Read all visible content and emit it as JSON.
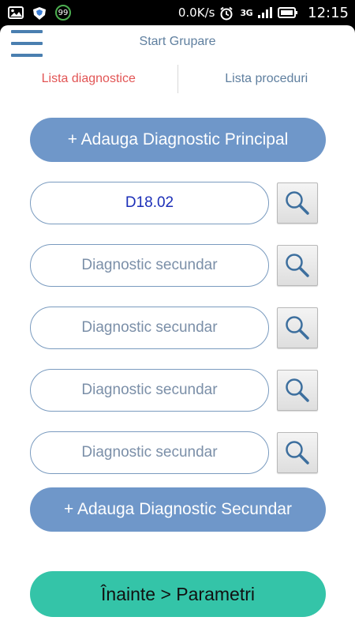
{
  "status_bar": {
    "speed": "0.0K/s",
    "network": "3G",
    "time": "12:15",
    "badge": "99",
    "icons": [
      "image-icon",
      "shield-icon",
      "badge-99-icon",
      "alarm-icon",
      "signal-icon",
      "battery-icon"
    ]
  },
  "header": {
    "title": "Start Grupare",
    "menu_icon": "hamburger-menu-icon"
  },
  "tabs": [
    {
      "label": "Lista diagnostice",
      "active": true
    },
    {
      "label": "Lista proceduri",
      "active": false
    }
  ],
  "main": {
    "add_principal_label": "+ Adauga Diagnostic Principal",
    "principal_value": "D18.02",
    "secondary_placeholder": "Diagnostic secundar",
    "secondary_rows": [
      "Diagnostic secundar",
      "Diagnostic secundar",
      "Diagnostic secundar",
      "Diagnostic secundar"
    ],
    "add_secondary_label": "+ Adauga Diagnostic Secundar",
    "next_label": "Înainte > Parametri"
  },
  "colors": {
    "accent_blue": "#6f97c9",
    "accent_green": "#34c4a8",
    "active_tab": "#e25555",
    "inactive_tab": "#5f7f9f",
    "filled_value": "#1c2fb8"
  }
}
